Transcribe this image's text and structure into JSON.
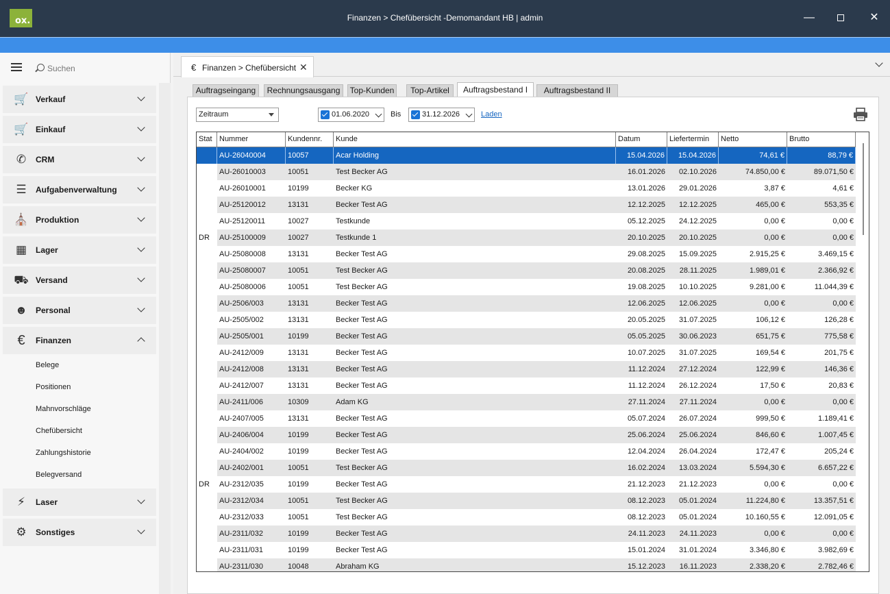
{
  "window": {
    "title": "Finanzen > Chefübersicht -Demomandant HB | admin",
    "logo_text": "ox."
  },
  "sidebar": {
    "search_placeholder": "Suchen",
    "items": [
      {
        "label": "Verkauf",
        "icon": "cart-euro-icon"
      },
      {
        "label": "Einkauf",
        "icon": "shopping-cart-icon"
      },
      {
        "label": "CRM",
        "icon": "phone-icon"
      },
      {
        "label": "Aufgabenverwaltung",
        "icon": "checklist-icon"
      },
      {
        "label": "Produktion",
        "icon": "factory-icon"
      },
      {
        "label": "Lager",
        "icon": "warehouse-icon"
      },
      {
        "label": "Versand",
        "icon": "truck-icon"
      },
      {
        "label": "Personal",
        "icon": "people-icon"
      },
      {
        "label": "Finanzen",
        "icon": "euro-icon",
        "expanded": true
      },
      {
        "label": "Laser",
        "icon": "lightning-icon"
      },
      {
        "label": "Sonstiges",
        "icon": "gear-icon"
      }
    ],
    "finanzen_subitems": [
      "Belege",
      "Positionen",
      "Mahnvorschläge",
      "Chefübersicht",
      "Zahlungshistorie",
      "Belegversand"
    ]
  },
  "doc_tab": {
    "label": "Finanzen > Chefübersicht",
    "close": "✕"
  },
  "subtabs": [
    "Auftragseingang",
    "Rechnungsausgang",
    "Top-Kunden",
    "Top-Artikel",
    "Auftragsbestand I",
    "Auftragsbestand II"
  ],
  "active_subtab": "Auftragsbestand I",
  "filter": {
    "period_select": "Zeitraum",
    "date_from": "01.06.2020",
    "bis_label": "Bis",
    "date_to": "31.12.2026",
    "load_link": "Laden"
  },
  "table": {
    "columns": [
      "Stat",
      "Nummer",
      "Kundennr.",
      "Kunde",
      "Datum",
      "Liefertermin",
      "Netto",
      "Brutto"
    ],
    "rows": [
      [
        "",
        "AU-26040004",
        "10057",
        "Acar Holding",
        "15.04.2026",
        "15.04.2026",
        "74,61 €",
        "88,79 €"
      ],
      [
        "",
        "AU-26010003",
        "10051",
        "Test Becker AG",
        "16.01.2026",
        "02.10.2026",
        "74.850,00 €",
        "89.071,50 €"
      ],
      [
        "",
        "AU-26010001",
        "10199",
        "Becker KG",
        "13.01.2026",
        "29.01.2026",
        "3,87 €",
        "4,61 €"
      ],
      [
        "",
        "AU-25120012",
        "13131",
        "Becker Test AG",
        "12.12.2025",
        "12.12.2025",
        "465,00 €",
        "553,35 €"
      ],
      [
        "",
        "AU-25120011",
        "10027",
        "Testkunde",
        "05.12.2025",
        "24.12.2025",
        "0,00 €",
        "0,00 €"
      ],
      [
        "DR",
        "AU-25100009",
        "10027",
        "Testkunde 1",
        "20.10.2025",
        "20.10.2025",
        "0,00 €",
        "0,00 €"
      ],
      [
        "",
        "AU-25080008",
        "13131",
        "Becker Test AG",
        "29.08.2025",
        "15.09.2025",
        "2.915,25 €",
        "3.469,15 €"
      ],
      [
        "",
        "AU-25080007",
        "10051",
        "Test Becker AG",
        "20.08.2025",
        "28.11.2025",
        "1.989,01 €",
        "2.366,92 €"
      ],
      [
        "",
        "AU-25080006",
        "10051",
        "Test Becker AG",
        "19.08.2025",
        "10.10.2025",
        "9.281,00 €",
        "11.044,39 €"
      ],
      [
        "",
        "AU-2506/003",
        "13131",
        "Becker Test AG",
        "12.06.2025",
        "12.06.2025",
        "0,00 €",
        "0,00 €"
      ],
      [
        "",
        "AU-2505/002",
        "13131",
        "Becker Test AG",
        "20.05.2025",
        "31.07.2025",
        "106,12 €",
        "126,28 €"
      ],
      [
        "",
        "AU-2505/001",
        "10199",
        "Becker Test AG",
        "05.05.2025",
        "30.06.2023",
        "651,75 €",
        "775,58 €"
      ],
      [
        "",
        "AU-2412/009",
        "13131",
        "Becker Test AG",
        "10.07.2025",
        "31.07.2025",
        "169,54 €",
        "201,75 €"
      ],
      [
        "",
        "AU-2412/008",
        "13131",
        "Becker Test AG",
        "11.12.2024",
        "27.12.2024",
        "122,99 €",
        "146,36 €"
      ],
      [
        "",
        "AU-2412/007",
        "13131",
        "Becker Test AG",
        "11.12.2024",
        "26.12.2024",
        "17,50 €",
        "20,83 €"
      ],
      [
        "",
        "AU-2411/006",
        "10309",
        "Adam KG",
        "27.11.2024",
        "27.11.2024",
        "0,00 €",
        "0,00 €"
      ],
      [
        "",
        "AU-2407/005",
        "13131",
        "Becker Test AG",
        "05.07.2024",
        "26.07.2024",
        "999,50 €",
        "1.189,41 €"
      ],
      [
        "",
        "AU-2406/004",
        "10199",
        "Becker Test AG",
        "25.06.2024",
        "25.06.2024",
        "846,60 €",
        "1.007,45 €"
      ],
      [
        "",
        "AU-2404/002",
        "10199",
        "Becker Test AG",
        "12.04.2024",
        "26.04.2024",
        "172,47 €",
        "205,24 €"
      ],
      [
        "",
        "AU-2402/001",
        "10051",
        "Test Becker AG",
        "16.02.2024",
        "13.03.2024",
        "5.594,30 €",
        "6.657,22 €"
      ],
      [
        "DR",
        "AU-2312/035",
        "10199",
        "Becker Test AG",
        "21.12.2023",
        "21.12.2023",
        "0,00 €",
        "0,00 €"
      ],
      [
        "",
        "AU-2312/034",
        "10051",
        "Test Becker AG",
        "08.12.2023",
        "05.01.2024",
        "11.224,80 €",
        "13.357,51 €"
      ],
      [
        "",
        "AU-2312/033",
        "10051",
        "Test Becker AG",
        "08.12.2023",
        "05.01.2024",
        "10.160,55 €",
        "12.091,05 €"
      ],
      [
        "",
        "AU-2311/032",
        "10199",
        "Becker Test AG",
        "24.11.2023",
        "24.11.2023",
        "0,00 €",
        "0,00 €"
      ],
      [
        "",
        "AU-2311/031",
        "10199",
        "Becker Test AG",
        "15.01.2024",
        "31.01.2024",
        "3.346,80 €",
        "3.982,69 €"
      ],
      [
        "",
        "AU-2311/030",
        "10048",
        "Abraham KG",
        "15.12.2023",
        "16.11.2023",
        "2.338,20 €",
        "2.782,46 €"
      ]
    ],
    "selected_row": 0
  },
  "colors": {
    "titlebar": "#2b3a4c",
    "accent": "#3d8ee8",
    "logo": "#8cb23a",
    "selection": "#1566c0"
  }
}
